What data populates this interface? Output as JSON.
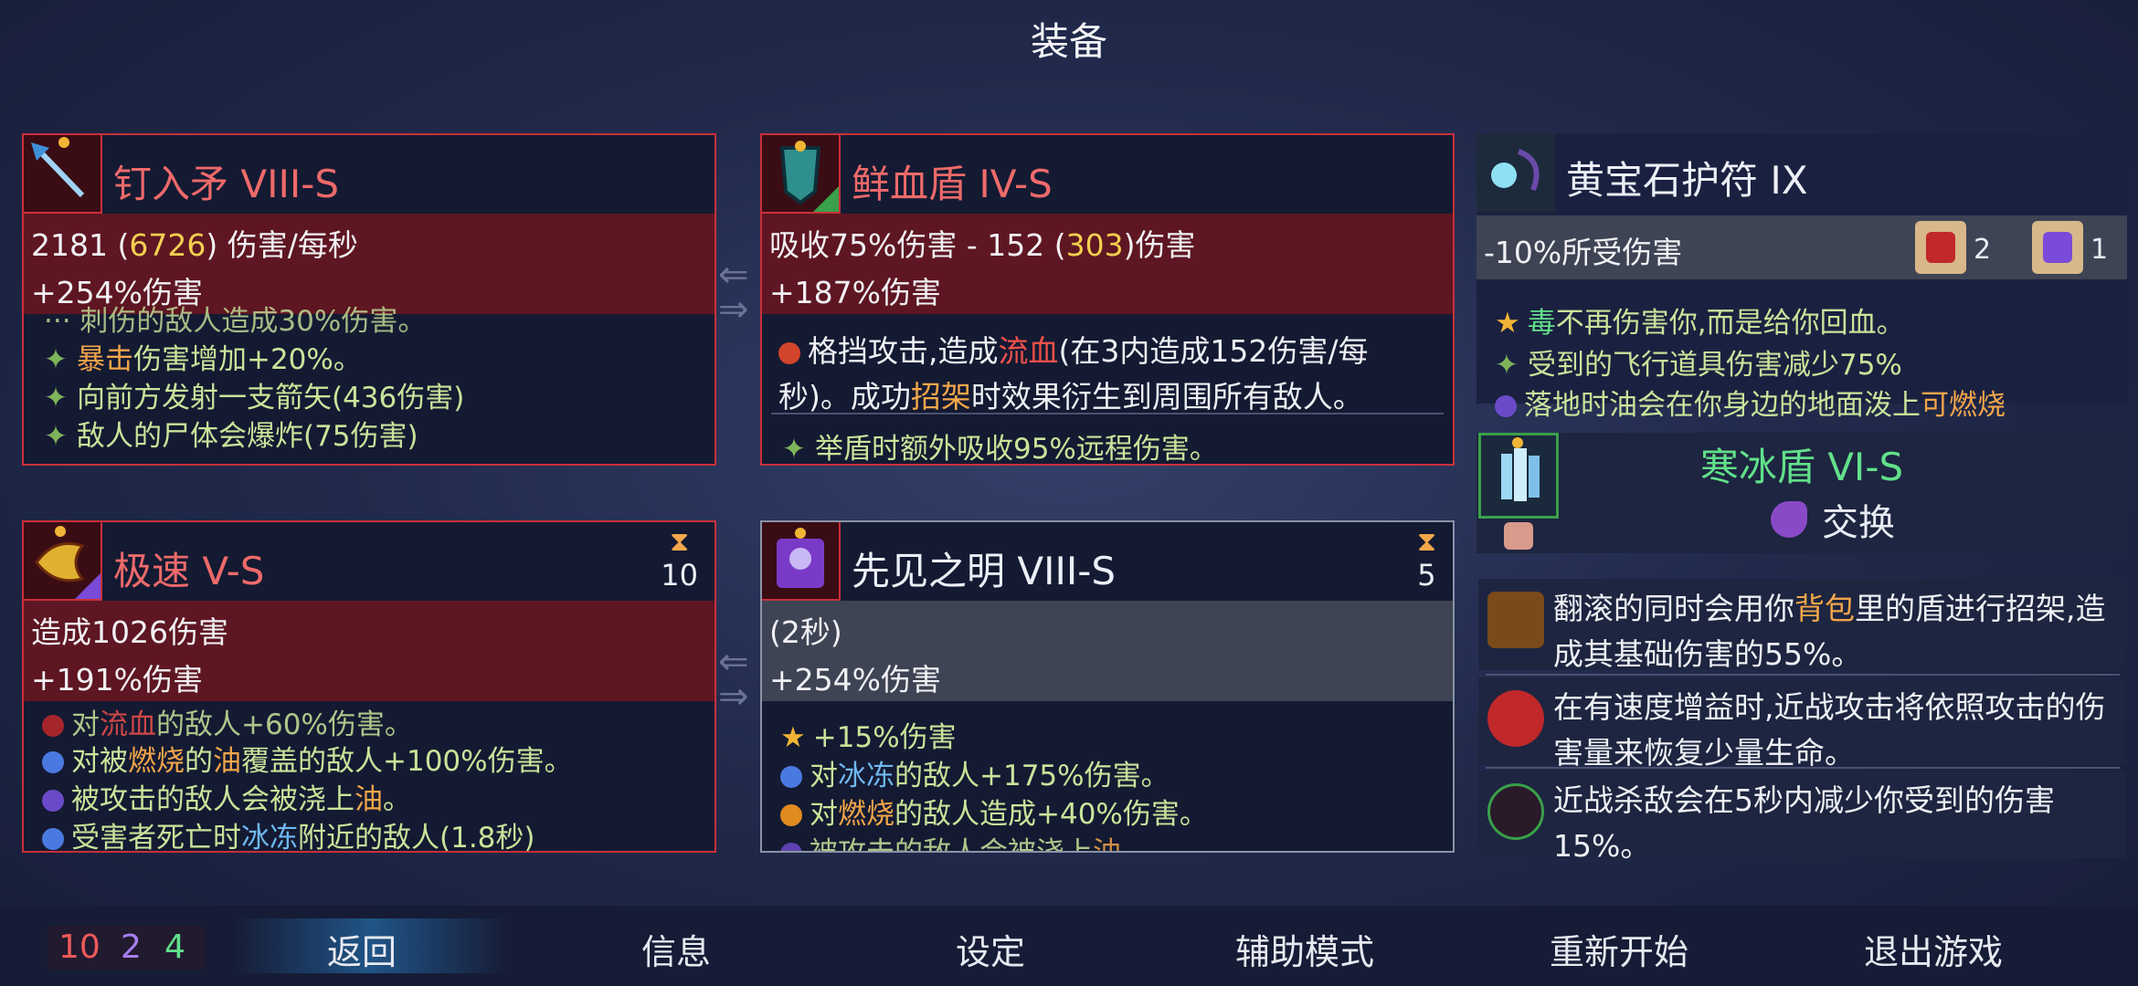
{
  "screen_title": "装备",
  "weapon1": {
    "title": "钉入矛 VIII-S",
    "stat1": {
      "a": "2181 (",
      "b": "6726",
      "c": ") 伤害/每秒"
    },
    "stat2": "+254%伤害",
    "cut_line": "··· 刺伤的敌人造成30%伤害。",
    "fx": [
      {
        "hl": "暴击",
        "rest": "伤害增加+20%。"
      },
      {
        "text": "向前方发射一支箭矢(436伤害)"
      },
      {
        "text": "敌人的尸体会爆炸(75伤害)"
      }
    ]
  },
  "shield1": {
    "title": "鲜血盾 IV-S",
    "stat1": {
      "a": "吸收75%伤害 - 152 (",
      "b": "303",
      "c": ")伤害"
    },
    "stat2": "+187%伤害",
    "desc1": {
      "a": "格挡攻击,造成",
      "b": "流血",
      "c": "(在3内造成152伤害/每"
    },
    "desc2": {
      "a": "秒)。成功",
      "b": "招架",
      "c": "时效果衍生到周围所有敌人。"
    },
    "fx": "举盾时额外吸收95%远程伤害。"
  },
  "amulet": {
    "title": "黄宝石护符 IX",
    "stat1": "-10%所受伤害",
    "scroll_counts": [
      "2",
      "1"
    ],
    "fx1": {
      "a": "毒",
      "b": "不再伤害你,而是给你回血。"
    },
    "fx2": "受到的飞行道具伤害减少75%",
    "fx3": {
      "a": "落地时油会在你身边的地面泼上",
      "b": "可燃烧"
    }
  },
  "skill1": {
    "title": "极速 V-S",
    "cooldown": "10",
    "stat1": "造成1026伤害",
    "stat2": "+191%伤害",
    "fx": [
      {
        "a": "对",
        "b": "流血",
        "c": "的敌人+60%伤害。"
      },
      {
        "a": "对被",
        "b": "燃烧",
        "m": "的",
        "d": "油",
        "c": "覆盖的敌人+100%伤害。"
      },
      {
        "a": "被攻击的敌人会被浇上",
        "b": "油",
        "c": "。"
      },
      {
        "a": "受害者死亡时",
        "b": "冰冻",
        "c": "附近的敌人(1.8秒)"
      }
    ]
  },
  "skill2": {
    "title": "先见之明 VIII-S",
    "cooldown": "5",
    "stat1": "(2秒)",
    "stat2": "+254%伤害",
    "fx": [
      {
        "text": "+15%伤害"
      },
      {
        "a": "对",
        "b": "冰冻",
        "c": "的敌人+175%伤害。"
      },
      {
        "a": "对",
        "b": "燃烧",
        "c": "的敌人造成+40%伤害。"
      },
      {
        "a": "被攻击的敌人会被浇上",
        "b": "油",
        "c": "。"
      }
    ]
  },
  "backpack": {
    "title": "寒冰盾 VI-S",
    "swap_label": "交换"
  },
  "perks": [
    {
      "a": "翻滚的同时会用你",
      "b": "背包",
      "c": "里的盾进行招架,造成其基础伤害的55%。"
    },
    {
      "text": "在有速度增益时,近战攻击将依照攻击的伤害量来恢复少量生命。"
    },
    {
      "text": "近战杀敌会在5秒内减少你受到的伤害15%。"
    }
  ],
  "bottom": {
    "counts": [
      "10",
      "2",
      "4"
    ],
    "nav": [
      "返回",
      "信息",
      "设定",
      "辅助模式",
      "重新开始",
      "退出游戏"
    ]
  },
  "colors": {
    "accent_red": "#c9303a",
    "stat_band": "#5e1622",
    "highlight_gold": "#f4d050",
    "keyword_red": "#f0504a",
    "keyword_blue": "#6fb8f0",
    "positive_green": "#62e08a"
  }
}
